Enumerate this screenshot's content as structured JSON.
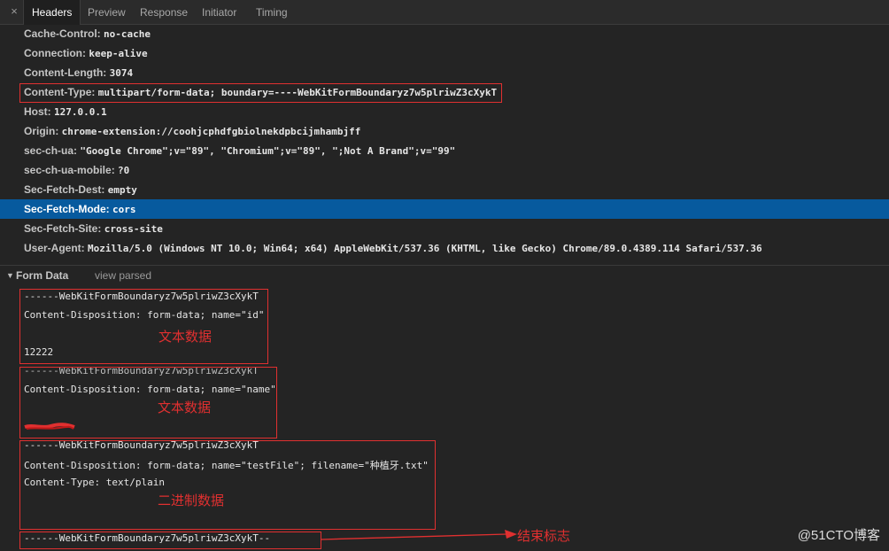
{
  "tabs": {
    "close_glyph": "×",
    "items": [
      "Headers",
      "Preview",
      "Response",
      "Initiator",
      "Timing"
    ],
    "active": "Headers"
  },
  "headers": [
    {
      "key": "Cache-Control:",
      "value": "no-cache"
    },
    {
      "key": "Connection:",
      "value": "keep-alive"
    },
    {
      "key": "Content-Length:",
      "value": "3074"
    },
    {
      "key": "Content-Type:",
      "value": "multipart/form-data; boundary=----WebKitFormBoundaryz7w5plriwZ3cXykT"
    },
    {
      "key": "Host:",
      "value": "127.0.0.1"
    },
    {
      "key": "Origin:",
      "value": "chrome-extension://coohjcphdfgbiolnekdpbcijmhambjff"
    },
    {
      "key": "sec-ch-ua:",
      "value": "\"Google Chrome\";v=\"89\", \"Chromium\";v=\"89\", \";Not A Brand\";v=\"99\""
    },
    {
      "key": "sec-ch-ua-mobile:",
      "value": "?0"
    },
    {
      "key": "Sec-Fetch-Dest:",
      "value": "empty"
    },
    {
      "key": "Sec-Fetch-Mode:",
      "value": "cors"
    },
    {
      "key": "Sec-Fetch-Site:",
      "value": "cross-site"
    },
    {
      "key": "User-Agent:",
      "value": "Mozilla/5.0 (Windows NT 10.0; Win64; x64) AppleWebKit/537.36 (KHTML, like Gecko) Chrome/89.0.4389.114 Safari/537.36"
    }
  ],
  "selected_header": "Sec-Fetch-Mode:",
  "form_data": {
    "title": "Form Data",
    "view_parsed": "view parsed",
    "lines": {
      "boundary1": "------WebKitFormBoundaryz7w5plriwZ3cXykT",
      "disp_id": "Content-Disposition: form-data; name=\"id\"",
      "value_id": "12222",
      "boundary2": "------WebKitFormBoundaryz7w5plriwZ3cXykT",
      "disp_name": "Content-Disposition: form-data; name=\"name\"",
      "boundary3": "------WebKitFormBoundaryz7w5plriwZ3cXykT",
      "disp_file": "Content-Disposition: form-data; name=\"testFile\"; filename=\"种植牙.txt\"",
      "type_file": "Content-Type: text/plain",
      "boundary_end": "------WebKitFormBoundaryz7w5plriwZ3cXykT--"
    }
  },
  "annotations": {
    "text_data_1": "文本数据",
    "text_data_2": "文本数据",
    "binary_data": "二进制数据",
    "end_marker": "结束标志",
    "color": "#e03030"
  },
  "watermark": "@51CTO博客"
}
